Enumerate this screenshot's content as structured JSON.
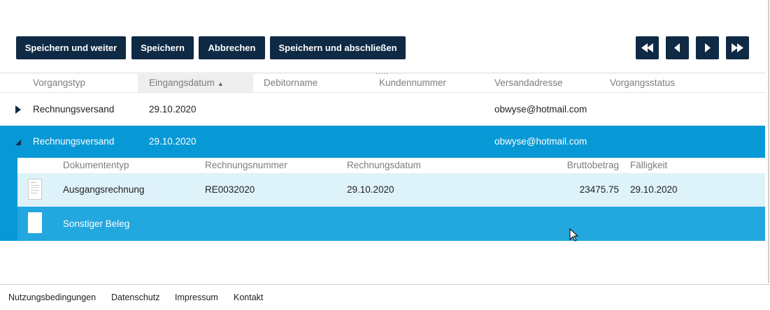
{
  "toolbar": {
    "save_continue": "Speichern und weiter",
    "save": "Speichern",
    "cancel": "Abbrechen",
    "save_finish": "Speichern und abschließen"
  },
  "nav_icons": [
    "first-page-icon",
    "previous-page-icon",
    "next-page-icon",
    "last-page-icon"
  ],
  "grid": {
    "resize_handle": ".....",
    "columns": [
      "Vorgangstyp",
      "Eingangsdatum",
      "Debitorname",
      "Kundennummer",
      "Versandadresse",
      "Vorgangsstatus"
    ],
    "sorted_column": "Eingangsdatum",
    "sort_direction": "ascending",
    "rows": [
      {
        "type": "Rechnungsversand",
        "date": "29.10.2020",
        "debtor": "",
        "customer_no": "",
        "address": "obwyse@hotmail.com",
        "status": "",
        "expanded": false
      },
      {
        "type": "Rechnungsversand",
        "date": "29.10.2020",
        "debtor": "",
        "customer_no": "",
        "address": "obwyse@hotmail.com",
        "status": "",
        "expanded": true
      }
    ]
  },
  "detail": {
    "columns": [
      "Dokumententyp",
      "Rechnungsnummer",
      "Rechnungsdatum",
      "Bruttobetrag",
      "Fälligkeit"
    ],
    "rows": [
      {
        "doc_type": "Ausgangsrechnung",
        "invoice_no": "RE0032020",
        "invoice_date": "29.10.2020",
        "gross": "23475.75",
        "due": "29.10.2020"
      },
      {
        "doc_type": "Sonstiger Beleg",
        "invoice_no": "",
        "invoice_date": "",
        "gross": "",
        "due": ""
      }
    ]
  },
  "footer": {
    "terms": "Nutzungsbedingungen",
    "privacy": "Datenschutz",
    "imprint": "Impressum",
    "contact": "Kontakt"
  },
  "colors": {
    "button_bg": "#0f2a45",
    "selected_row": "#0799d6",
    "detail_selected_row": "#23a7df",
    "detail_row_light": "#def2fa"
  }
}
